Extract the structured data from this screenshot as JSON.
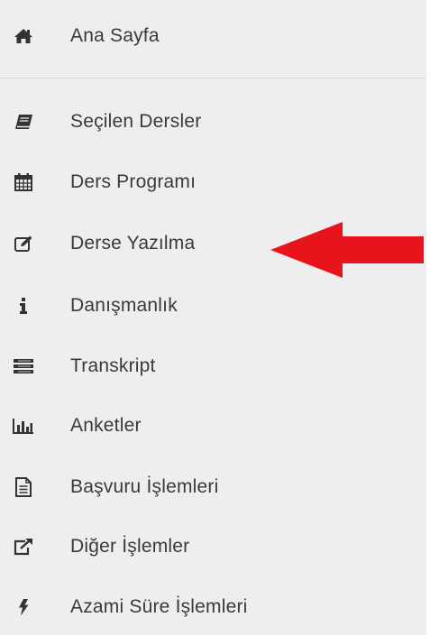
{
  "sidebar": {
    "items": [
      {
        "label": "Ana Sayfa",
        "icon": "home-icon"
      },
      {
        "label": "Seçilen Dersler",
        "icon": "book-icon"
      },
      {
        "label": "Ders Programı",
        "icon": "calendar-icon"
      },
      {
        "label": "Derse Yazılma",
        "icon": "edit-icon"
      },
      {
        "label": "Danışmanlık",
        "icon": "info-icon"
      },
      {
        "label": "Transkript",
        "icon": "list-icon"
      },
      {
        "label": "Anketler",
        "icon": "bar-chart-icon"
      },
      {
        "label": "Başvuru İşlemleri",
        "icon": "file-text-icon"
      },
      {
        "label": "Diğer İşlemler",
        "icon": "external-link-icon"
      },
      {
        "label": "Azami Süre İşlemleri",
        "icon": "bolt-icon"
      }
    ],
    "background": "#eeeeee",
    "text_color": "#3a3a3a"
  },
  "annotation": {
    "arrow_color": "#e8141b",
    "points_to": "Derse Yazılma"
  }
}
